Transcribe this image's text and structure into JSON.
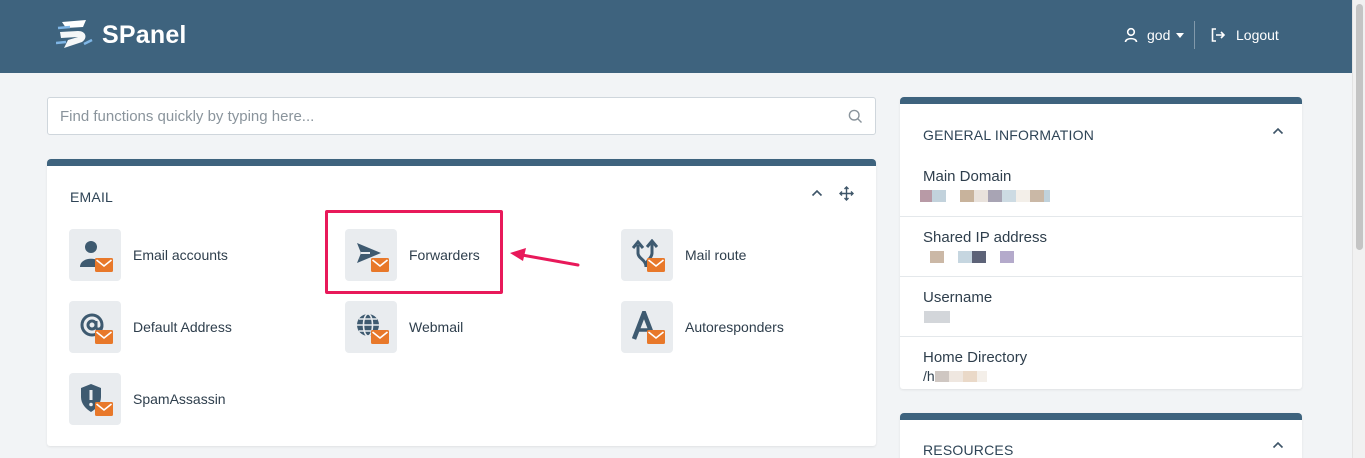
{
  "app": {
    "logo_text": "SPanel",
    "colors": {
      "header": "#3e637e",
      "accent_orange": "#e8782a",
      "highlight": "#e8195a"
    }
  },
  "header": {
    "user": "god",
    "logout_label": "Logout"
  },
  "search": {
    "placeholder": "Find functions quickly by typing here..."
  },
  "email_section": {
    "title": "EMAIL",
    "items": [
      {
        "label": "Email accounts",
        "icon": "user-mail-icon"
      },
      {
        "label": "Forwarders",
        "icon": "send-mail-icon"
      },
      {
        "label": "Mail route",
        "icon": "route-mail-icon"
      },
      {
        "label": "Default Address",
        "icon": "at-mail-icon"
      },
      {
        "label": "Webmail",
        "icon": "globe-mail-icon"
      },
      {
        "label": "Autoresponders",
        "icon": "auto-mail-icon"
      },
      {
        "label": "SpamAssassin",
        "icon": "shield-mail-icon"
      }
    ]
  },
  "general_info": {
    "title": "GENERAL INFORMATION",
    "rows": [
      {
        "label": "Main Domain"
      },
      {
        "label": "Shared IP address"
      },
      {
        "label": "Username"
      },
      {
        "label": "Home Directory",
        "value_prefix": "/h"
      }
    ]
  },
  "resources": {
    "title": "RESOURCES"
  }
}
